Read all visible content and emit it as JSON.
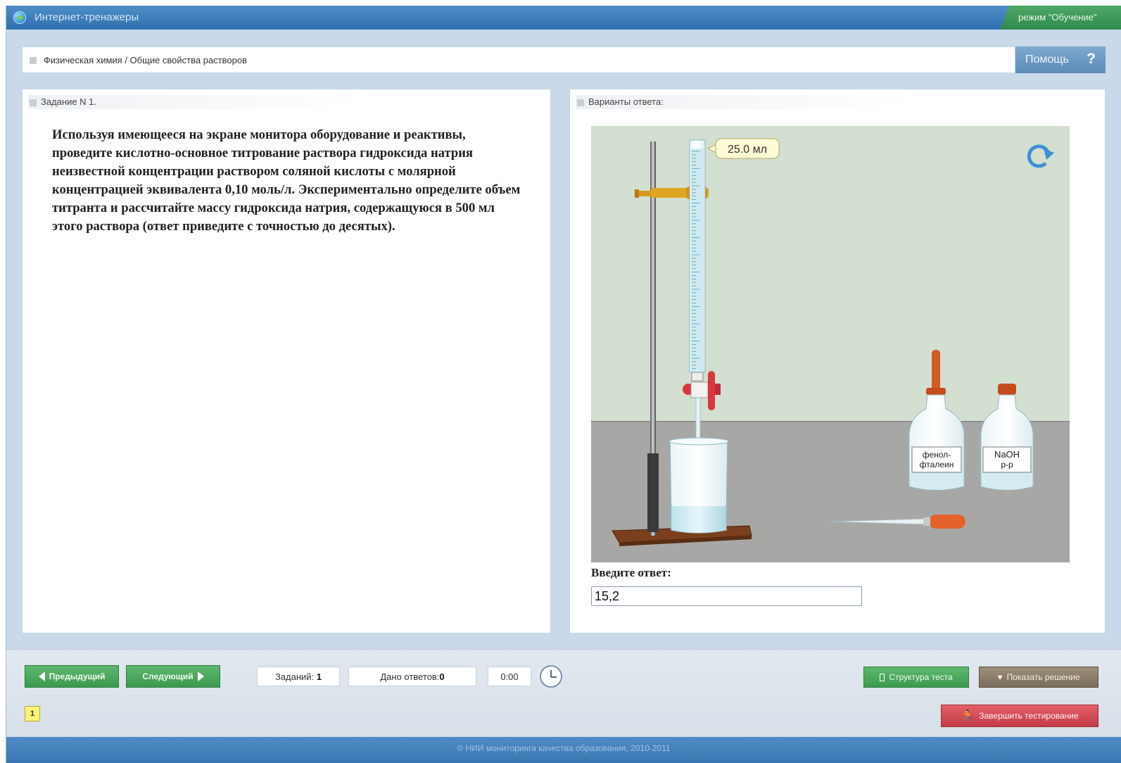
{
  "app": {
    "title": "Интернет-тренажеры",
    "mode": "режим \"Обучение\""
  },
  "breadcrumb": "Физическая химия / Общие свойства растворов",
  "help": {
    "label": "Помощь",
    "icon": "?"
  },
  "task": {
    "header": "Задание N 1.",
    "text": "Используя имеющееся на экране монитора оборудование и реактивы, проведите кислотно-основное титрование раствора гидроксида натрия неизвестной концентрации раствором соляной кислоты с молярной концентрацией эквивалента 0,10 моль/л. Экспериментально определите объем титранта и рассчитайте массу гидроксида натрия, содержащуюся в 500 мл этого раствора (ответ приведите с точностью до десятых)."
  },
  "answers": {
    "header": "Варианты ответа:",
    "burette_reading": "25.0 мл",
    "bottle_phenol": "фенол-\nфталеин",
    "bottle_naoh": "NaOH\nр-р",
    "input_label": "Введите ответ:",
    "input_value": "15,2"
  },
  "nav": {
    "prev": "Предыдущий",
    "next": "Следующий",
    "tasks_label": "Заданий:",
    "tasks_count": "1",
    "answers_label": "Дано ответов:",
    "answers_count": "0",
    "timer": "0:00",
    "structure": "Структура теста",
    "show_solution": "Показать решение",
    "finish": "Завершить тестирование",
    "page": "1"
  },
  "footer": "© НИИ мониторинга качества образования, 2010-2011",
  "colors": {
    "accent": "#3a76b1",
    "green": "#3b9a4e",
    "red": "#c33b46",
    "brown": "#7b6d5b"
  }
}
